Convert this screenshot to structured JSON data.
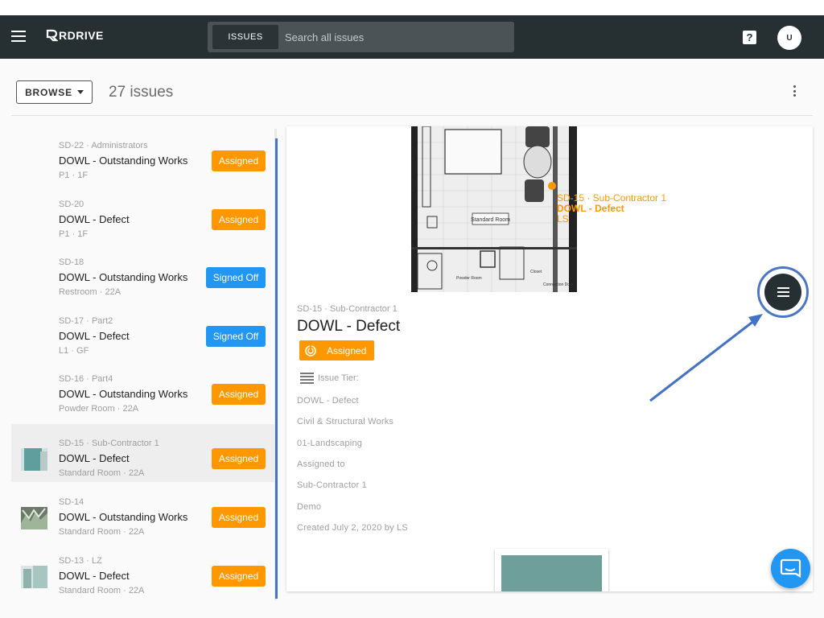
{
  "header": {
    "brand": "RDRIVE",
    "search": {
      "tab_label": "ISSUES",
      "placeholder": "Search all issues"
    },
    "avatar_initial": "U",
    "help_glyph": "?"
  },
  "toolbar": {
    "browse_label": "BROWSE",
    "issue_count": "27 issues"
  },
  "issues": [
    {
      "meta": "SD-22 · Administrators",
      "title": "DOWL - Outstanding Works",
      "location": "P1 · 1F",
      "status": "Assigned"
    },
    {
      "meta": "SD-20",
      "title": "DOWL - Defect",
      "location": "P1 · 1F",
      "status": "Assigned"
    },
    {
      "meta": "SD-18",
      "title": "DOWL - Outstanding Works",
      "location": "Restroom · 22A",
      "status": "Signed Off"
    },
    {
      "meta": "SD-17 · Part2",
      "title": "DOWL - Defect",
      "location": "L1 · GF",
      "status": "Signed Off"
    },
    {
      "meta": "SD-16 · Part4",
      "title": "DOWL - Outstanding Works",
      "location": "Powder Room · 22A",
      "status": "Assigned"
    },
    {
      "meta": "SD-15 · Sub-Contractor 1",
      "title": "DOWL - Defect",
      "location": "Standard Room · 22A",
      "status": "Assigned"
    },
    {
      "meta": "SD-14",
      "title": "DOWL - Outstanding Works",
      "location": "Standard Room · 22A",
      "status": "Assigned"
    },
    {
      "meta": "SD-13 · LZ",
      "title": "DOWL - Defect",
      "location": "Standard Room · 22A",
      "status": "Assigned"
    }
  ],
  "detail": {
    "meta": "SD-15 · Sub-Contractor 1",
    "title": "DOWL - Defect",
    "status": "Assigned",
    "tier_label": "Issue Tier:",
    "lines": [
      "DOWL - Defect",
      "Civil & Structural Works",
      "01-Landscaping",
      "Assigned to",
      "Sub-Contractor 1",
      "Demo",
      "Created July 2, 2020 by LS"
    ],
    "plan": {
      "room_label": "Standard Room",
      "pin_meta": "SD-15 · Sub-Contractor 1",
      "pin_title": "DOWL - Defect",
      "pin_user": "LS",
      "small_labels": [
        "Powder Room",
        "Closet",
        "Connection Door"
      ]
    }
  },
  "colors": {
    "topbar": "#263033",
    "assigned": "#ff9800",
    "signed_off": "#2196f3",
    "annotation": "#4472c4"
  }
}
